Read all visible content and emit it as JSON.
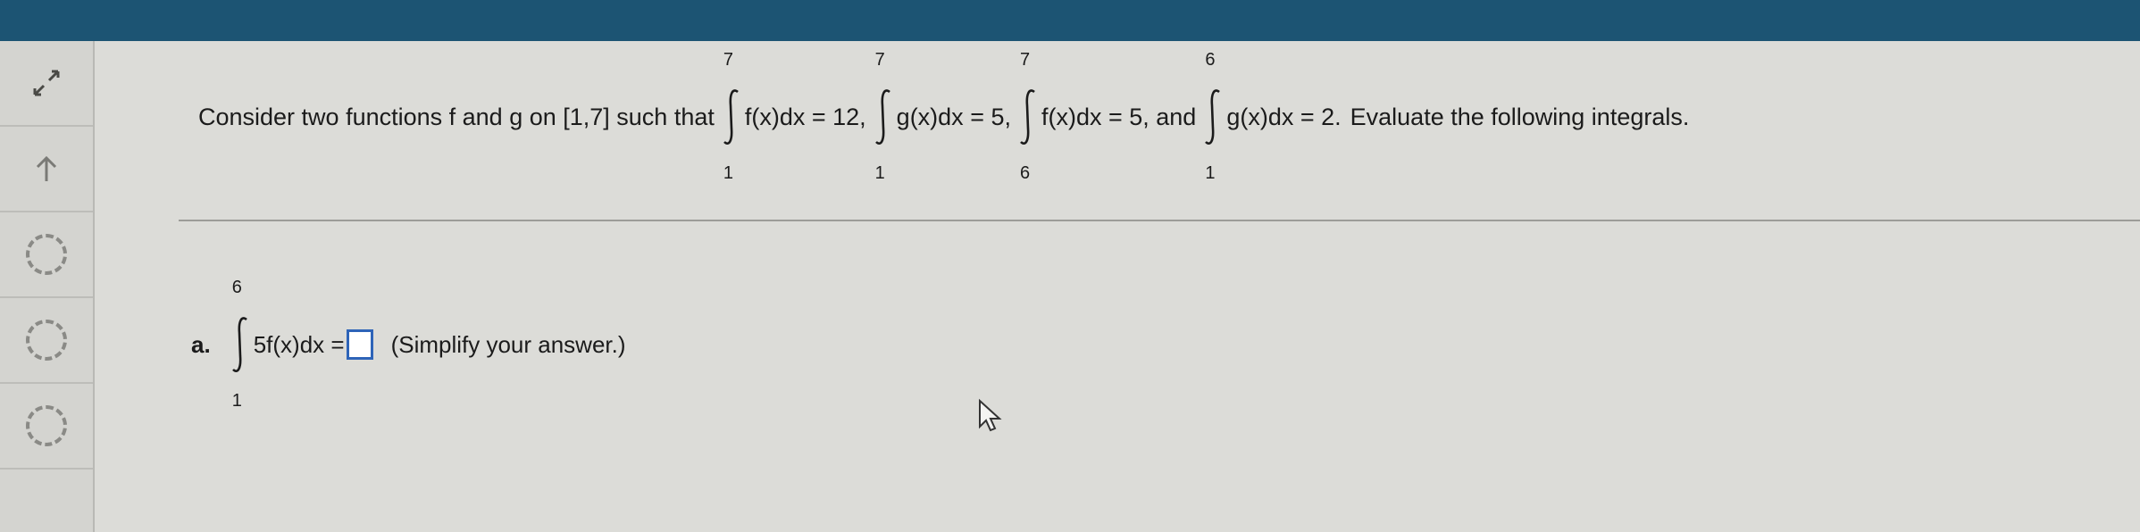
{
  "sidebar": {
    "buttons": [
      {
        "name": "expand-icon"
      },
      {
        "name": "up-arrow-icon"
      },
      {
        "name": "tool-circle-1"
      },
      {
        "name": "tool-circle-2"
      },
      {
        "name": "tool-circle-3"
      }
    ]
  },
  "question": {
    "intro": "Consider two functions f and g on [1,7] such that",
    "integrals": [
      {
        "upper": "7",
        "lower": "1",
        "expr": "f(x)dx = 12,"
      },
      {
        "upper": "7",
        "lower": "1",
        "expr": "g(x)dx = 5,"
      },
      {
        "upper": "7",
        "lower": "6",
        "expr": "f(x)dx = 5, and"
      },
      {
        "upper": "6",
        "lower": "1",
        "expr": "g(x)dx = 2."
      }
    ],
    "outro": "Evaluate the following integrals."
  },
  "part_a": {
    "label": "a.",
    "upper": "6",
    "lower": "1",
    "expr": "5f(x)dx =",
    "answer_value": "",
    "hint": "(Simplify your answer.)"
  }
}
